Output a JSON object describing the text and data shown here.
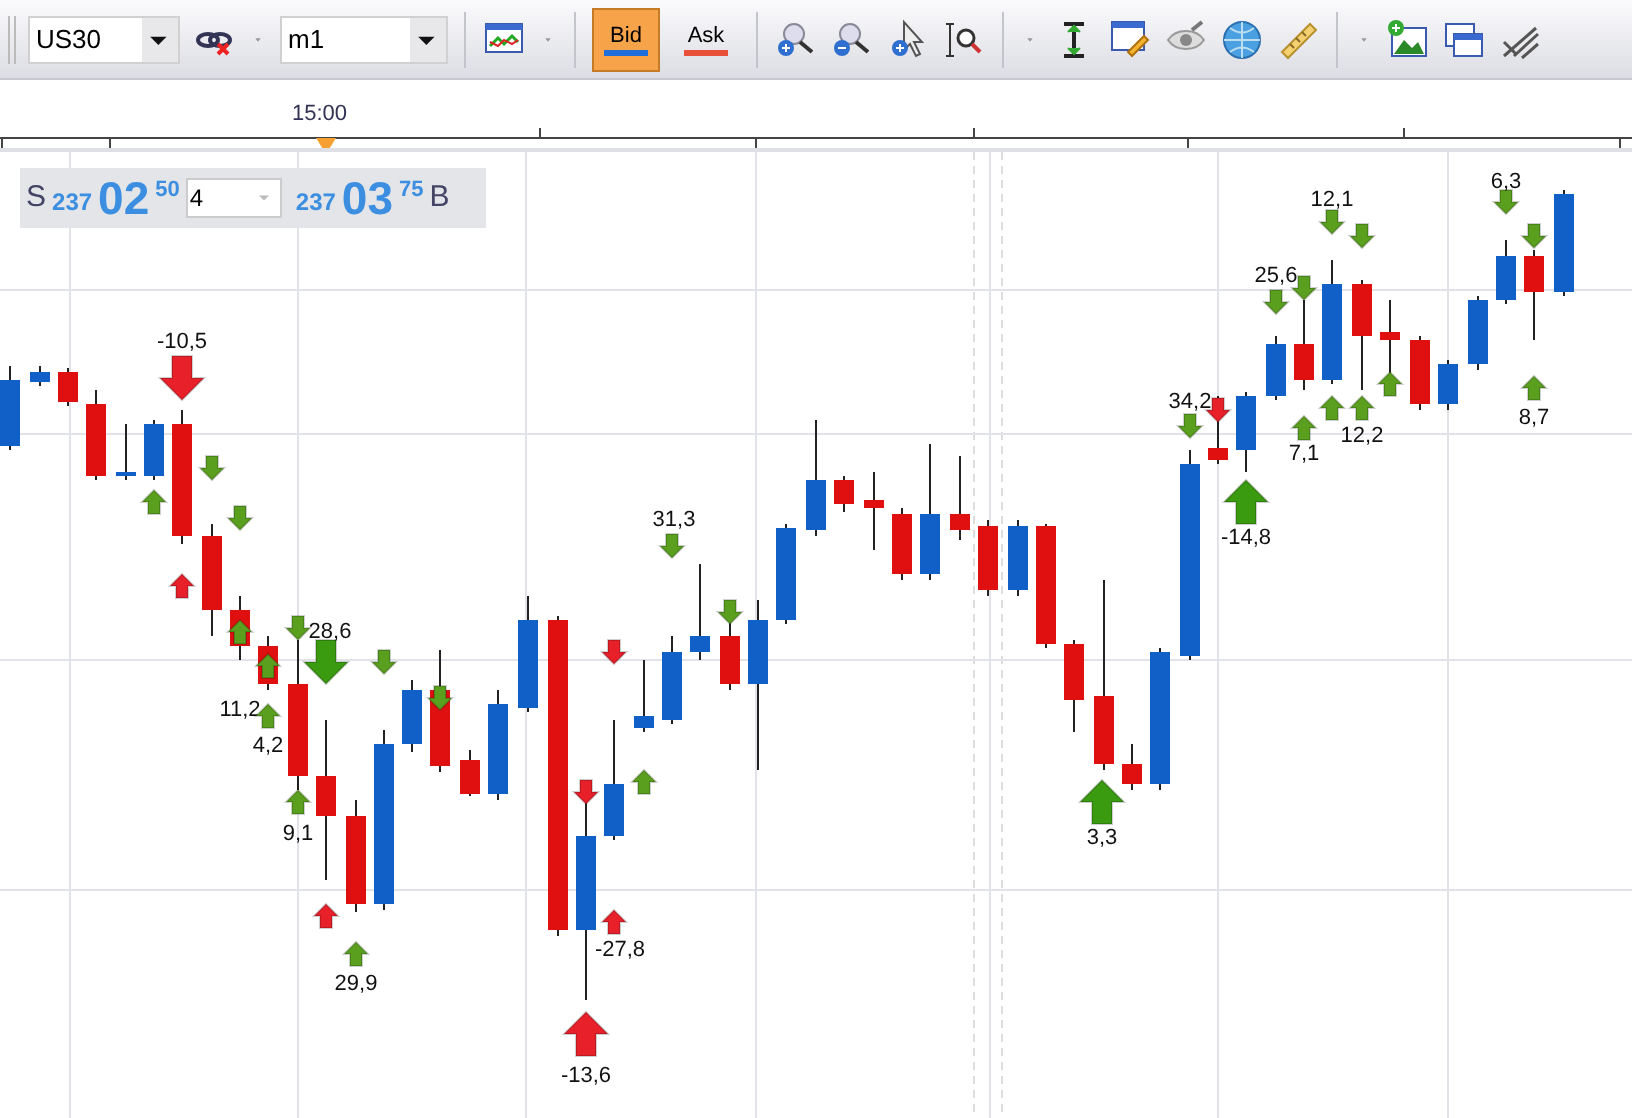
{
  "toolbar": {
    "symbol": "US30",
    "timeframe": "m1",
    "price_buttons": [
      {
        "label": "Bid",
        "selected": true,
        "color": "#1e6fd9"
      },
      {
        "label": "Ask",
        "selected": false,
        "color": "#e8503a"
      }
    ]
  },
  "time_axis": {
    "labels": [
      "15:00"
    ]
  },
  "quote_panel": {
    "sell_label": "S",
    "bid_big": "237",
    "bid_main": "02",
    "bid_sup": "50",
    "volume": "4",
    "ask_big": "237",
    "ask_main": "03",
    "ask_sup": "75",
    "buy_label": "B"
  },
  "markers": [
    {
      "kind": "bigdown",
      "color": "#e8202a",
      "label": "-10,5"
    },
    {
      "kind": "up",
      "color": "#5aa01e"
    },
    {
      "kind": "down",
      "color": "#5aa01e"
    },
    {
      "kind": "down",
      "color": "#5aa01e"
    },
    {
      "kind": "up",
      "color": "#e8202a"
    },
    {
      "kind": "up",
      "color": "#5aa01e"
    },
    {
      "kind": "down",
      "color": "#5aa01e"
    },
    {
      "kind": "bigdown",
      "color": "#3a9a10",
      "label": "28,6"
    },
    {
      "kind": "up",
      "color": "#5aa01e",
      "label": "11,2"
    },
    {
      "kind": "up",
      "color": "#5aa01e",
      "label": "4,2"
    },
    {
      "kind": "up",
      "color": "#5aa01e",
      "label": "9,1"
    },
    {
      "kind": "up",
      "color": "#e8202a"
    },
    {
      "kind": "up",
      "color": "#5aa01e",
      "label": "29,9"
    },
    {
      "kind": "down",
      "color": "#5aa01e"
    },
    {
      "kind": "down",
      "color": "#5aa01e"
    },
    {
      "kind": "bigup",
      "color": "#e8202a",
      "label": "-13,6"
    },
    {
      "kind": "down",
      "color": "#e8202a"
    },
    {
      "kind": "down",
      "color": "#e8202a"
    },
    {
      "kind": "up",
      "color": "#e8202a",
      "label": "-27,8"
    },
    {
      "kind": "up",
      "color": "#5aa01e"
    },
    {
      "kind": "down",
      "color": "#5aa01e",
      "label": "31,3"
    },
    {
      "kind": "down",
      "color": "#5aa01e"
    },
    {
      "kind": "bigup",
      "color": "#3a9a10",
      "label": "3,3"
    },
    {
      "kind": "down",
      "color": "#5aa01e",
      "label": "34,2"
    },
    {
      "kind": "down",
      "color": "#e8202a"
    },
    {
      "kind": "bigup",
      "color": "#3a9a10",
      "label": "-14,8"
    },
    {
      "kind": "down",
      "color": "#5aa01e"
    },
    {
      "kind": "down",
      "color": "#5aa01e",
      "label": "25,6"
    },
    {
      "kind": "down",
      "color": "#5aa01e",
      "label": "12,1"
    },
    {
      "kind": "down",
      "color": "#5aa01e"
    },
    {
      "kind": "up",
      "color": "#5aa01e",
      "label": "7,1"
    },
    {
      "kind": "up",
      "color": "#5aa01e"
    },
    {
      "kind": "up",
      "color": "#5aa01e",
      "label": "12,2"
    },
    {
      "kind": "up",
      "color": "#5aa01e"
    },
    {
      "kind": "down",
      "color": "#5aa01e",
      "label": "6,3"
    },
    {
      "kind": "down",
      "color": "#5aa01e"
    },
    {
      "kind": "up",
      "color": "#5aa01e",
      "label": "8,7"
    }
  ]
}
